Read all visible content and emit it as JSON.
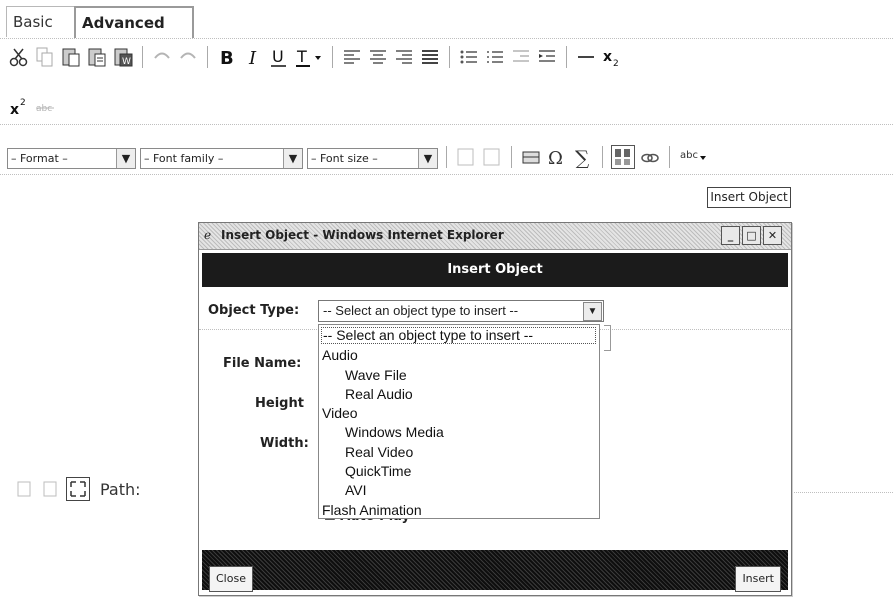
{
  "tabs": [
    {
      "label": "Basic"
    },
    {
      "label": "Advanced"
    }
  ],
  "toolbar": {
    "row1_icons": [
      "cut-icon",
      "copy-icon",
      "paste-icon",
      "paste-text-icon",
      "paste-word-icon",
      "undo-icon",
      "redo-icon",
      "bold-icon",
      "italic-icon",
      "underline-icon",
      "text-color-icon",
      "align-left-icon",
      "align-center-icon",
      "align-right-icon",
      "align-justify-icon",
      "bullet-list-icon",
      "numbered-list-icon",
      "outdent-icon",
      "indent-icon",
      "horizontal-rule-icon",
      "subscript-icon"
    ],
    "format_label": "– Format –",
    "font_family_label": "– Font family –",
    "font_size_label": "– Font size –",
    "tooltip": "Insert Object",
    "path_label": "Path:"
  },
  "dialog": {
    "window_title": "Insert Object - Windows Internet Explorer",
    "header": "Insert Object",
    "object_type_label": "Object Type:",
    "object_type_value": "-- Select an object type to insert --",
    "file_name_label": "File Name:",
    "height_label": "Height",
    "width_label": "Width:",
    "autoplay_label": "Auto Play",
    "options": [
      {
        "label": "-- Select an object type to insert --",
        "level": 0,
        "highlighted": true
      },
      {
        "label": "Audio",
        "level": 0
      },
      {
        "label": "Wave File",
        "level": 1
      },
      {
        "label": "Real Audio",
        "level": 1
      },
      {
        "label": "Video",
        "level": 0
      },
      {
        "label": "Windows Media",
        "level": 1
      },
      {
        "label": "Real Video",
        "level": 1
      },
      {
        "label": "QuickTime",
        "level": 1
      },
      {
        "label": "AVI",
        "level": 1
      },
      {
        "label": "Flash Animation",
        "level": 0
      }
    ],
    "close_label": "Close",
    "insert_label": "Insert"
  }
}
